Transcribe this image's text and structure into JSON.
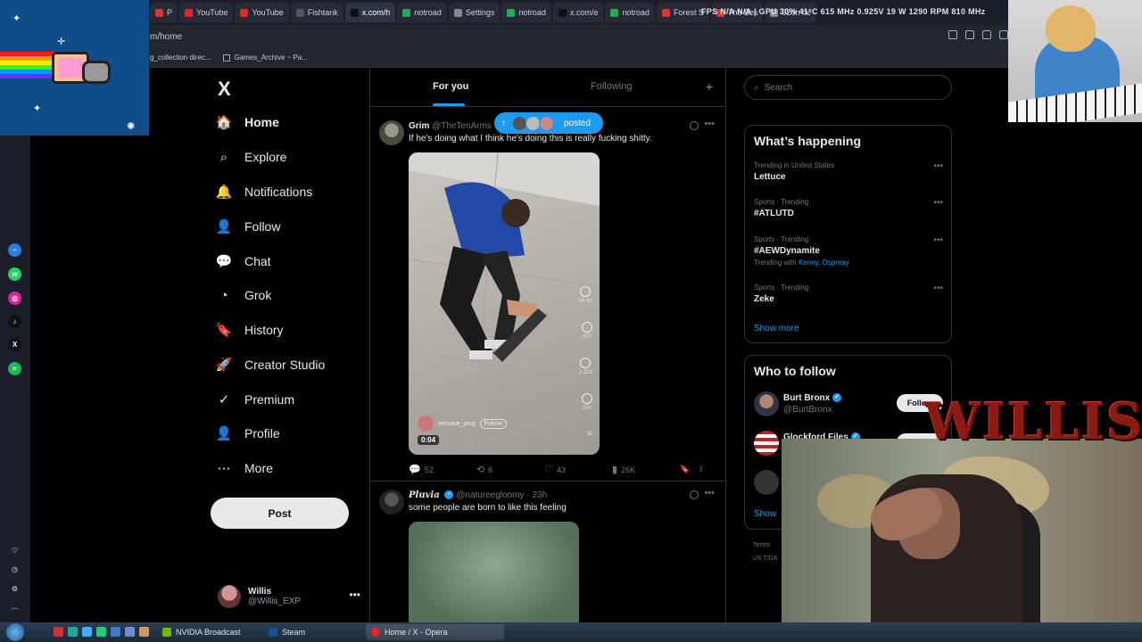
{
  "browser": {
    "tabs": [
      {
        "label": "P",
        "color": "#d33"
      },
      {
        "label": "YouTube",
        "color": "#e22"
      },
      {
        "label": "YouTube",
        "color": "#e22"
      },
      {
        "label": "Fishtank",
        "color": "#555"
      },
      {
        "label": "x.com/h",
        "color": "#111"
      },
      {
        "label": "notroad",
        "color": "#2a5"
      },
      {
        "label": "Settings",
        "color": "#888"
      },
      {
        "label": "notroad",
        "color": "#2a5"
      },
      {
        "label": "x.com/e",
        "color": "#111"
      },
      {
        "label": "notroad",
        "color": "#2a5"
      },
      {
        "label": "Forest S",
        "color": "#d33"
      },
      {
        "label": "The Bes",
        "color": "#d33"
      },
      {
        "label": "920h he",
        "color": "#888"
      }
    ],
    "overlay_stats": "FPS N/A  N/A  |  GPU 30% 41°C 615 MHz 0.925V 19 W 1290 RPM 810 MHz",
    "url": "m/home",
    "bookmarks": [
      "g_collection direc...",
      "Games_Archive ~ Pa..."
    ]
  },
  "nav": {
    "logo": "X",
    "items": [
      {
        "label": "Home",
        "icon": "🏠",
        "name": "home"
      },
      {
        "label": "Explore",
        "icon": "⌕",
        "name": "explore"
      },
      {
        "label": "Notifications",
        "icon": "🔔",
        "name": "notifications"
      },
      {
        "label": "Follow",
        "icon": "👤",
        "name": "follow"
      },
      {
        "label": "Chat",
        "icon": "💬",
        "name": "chat"
      },
      {
        "label": "Grok",
        "icon": "◔",
        "name": "grok"
      },
      {
        "label": "History",
        "icon": "🔖",
        "name": "history"
      },
      {
        "label": "Creator Studio",
        "icon": "🚀",
        "name": "creator-studio"
      },
      {
        "label": "Premium",
        "icon": "✓",
        "name": "premium"
      },
      {
        "label": "Profile",
        "icon": "👤",
        "name": "profile"
      },
      {
        "label": "More",
        "icon": "⋯",
        "name": "more"
      }
    ],
    "post_label": "Post",
    "account": {
      "name": "Willis",
      "handle": "@Willis_EXP"
    }
  },
  "feed": {
    "tabs": [
      "For you",
      "Following"
    ],
    "posted_label": "posted",
    "tweets": [
      {
        "name": "Grim",
        "handle": "@TheTenArms",
        "text": "If he's doing what I think he's doing this is really fucking shitty.",
        "video": {
          "likes": "54.8K",
          "comments": "951",
          "reposts": "2,323",
          "shares": "20K",
          "user": "versace_plug",
          "follow": "Follow",
          "duration": "0:04"
        },
        "actions": {
          "replies": "52",
          "reposts": "6",
          "likes": "43",
          "views": "26K"
        }
      },
      {
        "name": "Pluvia",
        "handle": "@natureegloomy · 23h",
        "text": "some people are born to like this feeling"
      }
    ]
  },
  "right": {
    "search_placeholder": "Search",
    "happening_title": "What’s happening",
    "trends": [
      {
        "meta": "Trending in United States",
        "title": "Lettuce",
        "with": ""
      },
      {
        "meta": "Sports · Trending",
        "title": "#ATLUTD",
        "with": ""
      },
      {
        "meta": "Sports · Trending",
        "title": "#AEWDynamite",
        "with_prefix": "Trending with",
        "with": "Kenny, Ospreay"
      },
      {
        "meta": "Sports · Trending",
        "title": "Zeke",
        "with": ""
      }
    ],
    "show_more": "Show more",
    "wtf_title": "Who to follow",
    "wtf": [
      {
        "name": "Burt Bronx",
        "handle": "@BurtBronx",
        "button": "Follow"
      },
      {
        "name": "Glockford Files",
        "handle": "",
        "button": "Follow"
      }
    ],
    "show_more_2": "Show",
    "footer": [
      "Terms",
      "US TIDA"
    ]
  },
  "overlays": {
    "webcam_logo": "WILLIS"
  },
  "taskbar": {
    "tasks": [
      "NVIDIA Broadcast",
      "Steam",
      "Home / X - Opera"
    ]
  }
}
